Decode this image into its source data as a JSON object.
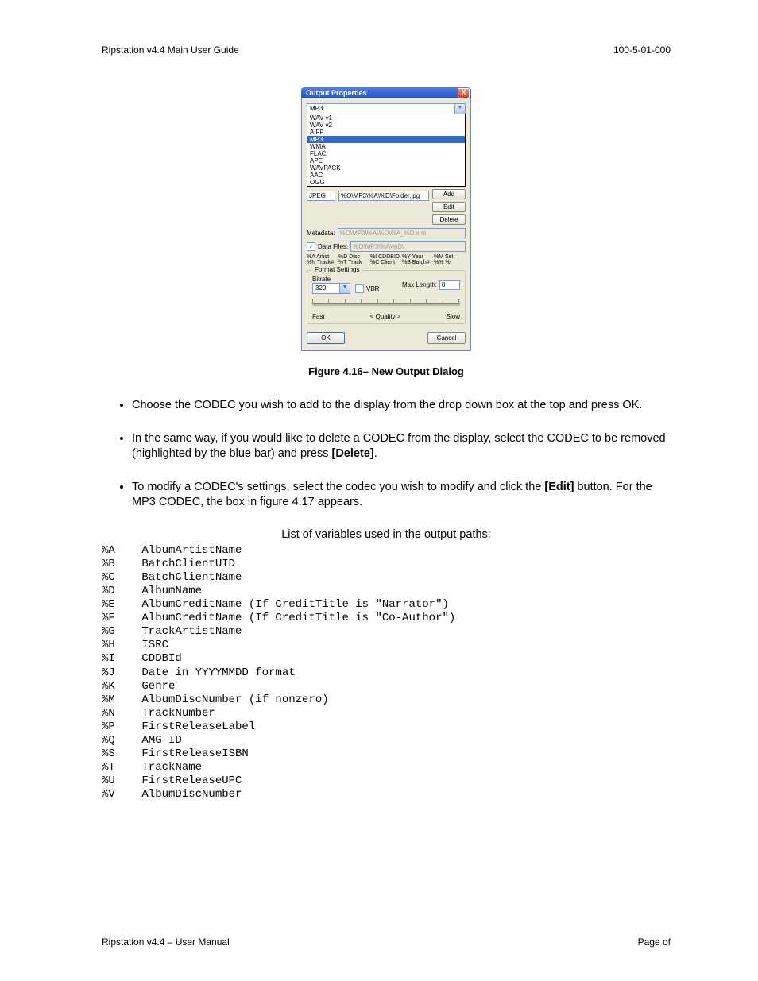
{
  "header": {
    "left": "Ripstation v4.4 Main User Guide",
    "right": "100-5-01-000"
  },
  "dialog": {
    "title": "Output Properties",
    "close_glyph": "X",
    "combo_selected": "MP3",
    "options": [
      "WAV v1",
      "WAV v2",
      "AIFF",
      "MP3",
      "WMA",
      "FLAC",
      "APE",
      "WAVPACK",
      "AAC",
      "OGG"
    ],
    "jpeg_row": {
      "label": "JPEG",
      "path": "%O\\MP3\\%A\\%D\\Folder.jpg"
    },
    "buttons": {
      "add": "Add",
      "edit": "Edit",
      "delete": "Delete"
    },
    "metadata": {
      "label": "Metadata:",
      "value": "%O\\MP3\\%A\\%D\\%A_%D.xml"
    },
    "datafiles": {
      "label": "Data Files:",
      "value": "%O\\MP3\\%A\\%D\\"
    },
    "datafiles_checked": "✓",
    "tokens": [
      "%A Artist",
      "%D Disc",
      "%I CDDBID",
      "%Y Year",
      "%M Set",
      "%N Track#",
      "%T Track",
      "%C Client",
      "%B Batch#",
      "%% %"
    ],
    "format": {
      "group_label": "Format Settings",
      "bitrate_label": "Bitrate",
      "bitrate_value": "320",
      "vbr_label": "VBR",
      "maxlen_label": "Max Length:",
      "maxlen_value": "0",
      "slider": {
        "left": "Fast",
        "center": "<  Quality  >",
        "right": "Slow"
      }
    },
    "bottom": {
      "ok": "OK",
      "cancel": "Cancel"
    }
  },
  "fig_caption": "Figure 4.16– New Output Dialog",
  "bullets": [
    {
      "text": "Choose the CODEC you wish to add to the display from the drop down box at the top and press OK."
    },
    {
      "pre": "In the same way, if you would like to delete a CODEC from the display, select the CODEC to be removed (highlighted by the blue bar) and press ",
      "bold": "[Delete]",
      "post": "."
    },
    {
      "pre": "To modify a CODEC's settings, select the codec you wish to modify and click the ",
      "bold": "[Edit]",
      "post": " button.  For the MP3 CODEC, the box in figure 4.17 appears."
    }
  ],
  "vars_heading": "List of variables used in the output paths:",
  "vars": [
    [
      "%A",
      "AlbumArtistName"
    ],
    [
      "%B",
      "BatchClientUID"
    ],
    [
      "%C",
      "BatchClientName"
    ],
    [
      "%D",
      "AlbumName"
    ],
    [
      "%E",
      "AlbumCreditName (If CreditTitle is \"Narrator\")"
    ],
    [
      "%F",
      "AlbumCreditName (If CreditTitle is \"Co-Author\")"
    ],
    [
      "%G",
      "TrackArtistName"
    ],
    [
      "%H",
      "ISRC"
    ],
    [
      "%I",
      "CDDBId"
    ],
    [
      "%J",
      "Date in YYYYMMDD format"
    ],
    [
      "%K",
      "Genre"
    ],
    [
      "%M",
      "AlbumDiscNumber (if nonzero)"
    ],
    [
      "%N",
      "TrackNumber"
    ],
    [
      "%P",
      "FirstReleaseLabel"
    ],
    [
      "%Q",
      "AMG ID"
    ],
    [
      "%S",
      "FirstReleaseISBN"
    ],
    [
      "%T",
      "TrackName"
    ],
    [
      "%U",
      "FirstReleaseUPC"
    ],
    [
      "%V",
      "AlbumDiscNumber"
    ]
  ],
  "footer": {
    "left": "Ripstation v4.4 – User Manual",
    "right": "Page    of"
  }
}
